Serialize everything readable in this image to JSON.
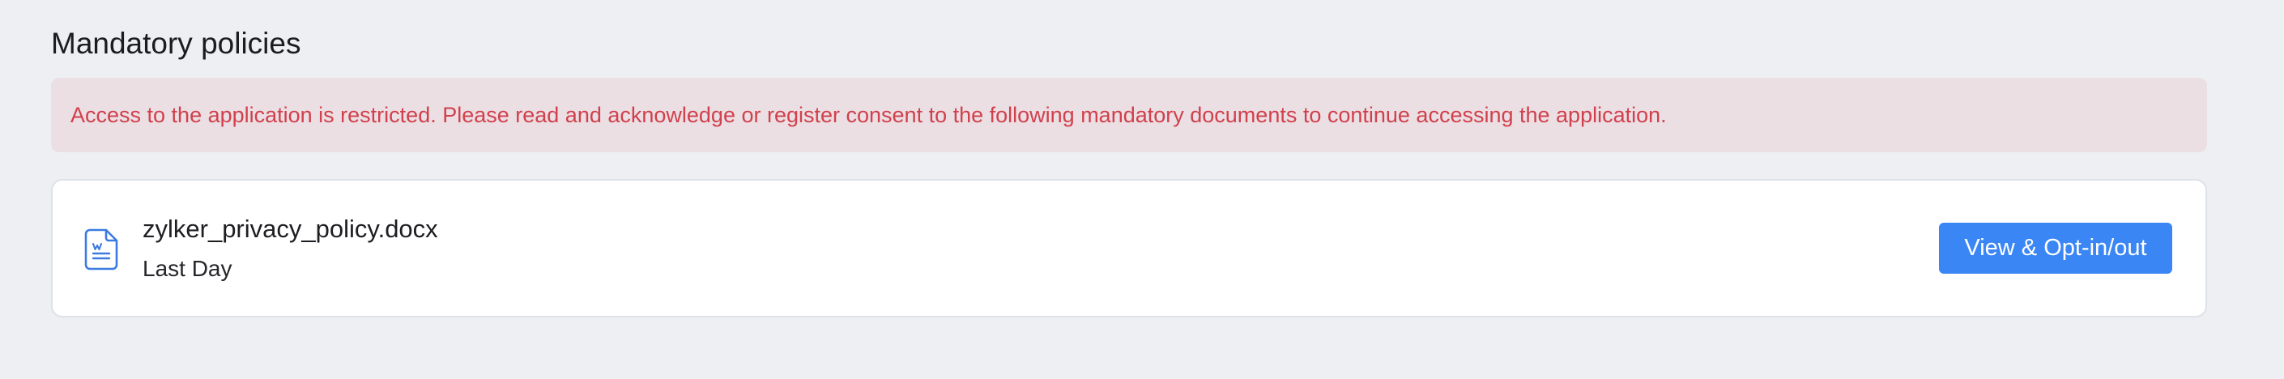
{
  "section": {
    "title": "Mandatory policies"
  },
  "alert": {
    "message": "Access to the application is restricted. Please read and acknowledge or register consent to the following mandatory documents to continue accessing the application.",
    "color": "#d1404d",
    "background": "#ebdfe3"
  },
  "documents": [
    {
      "file_name": "zylker_privacy_policy.docx",
      "deadline": "Last Day",
      "icon": "word-document-icon",
      "action_label": "View & Opt-in/out"
    }
  ],
  "colors": {
    "page_background": "#eeeff3",
    "accent": "#3a86f5",
    "icon": "#3b7be0"
  }
}
